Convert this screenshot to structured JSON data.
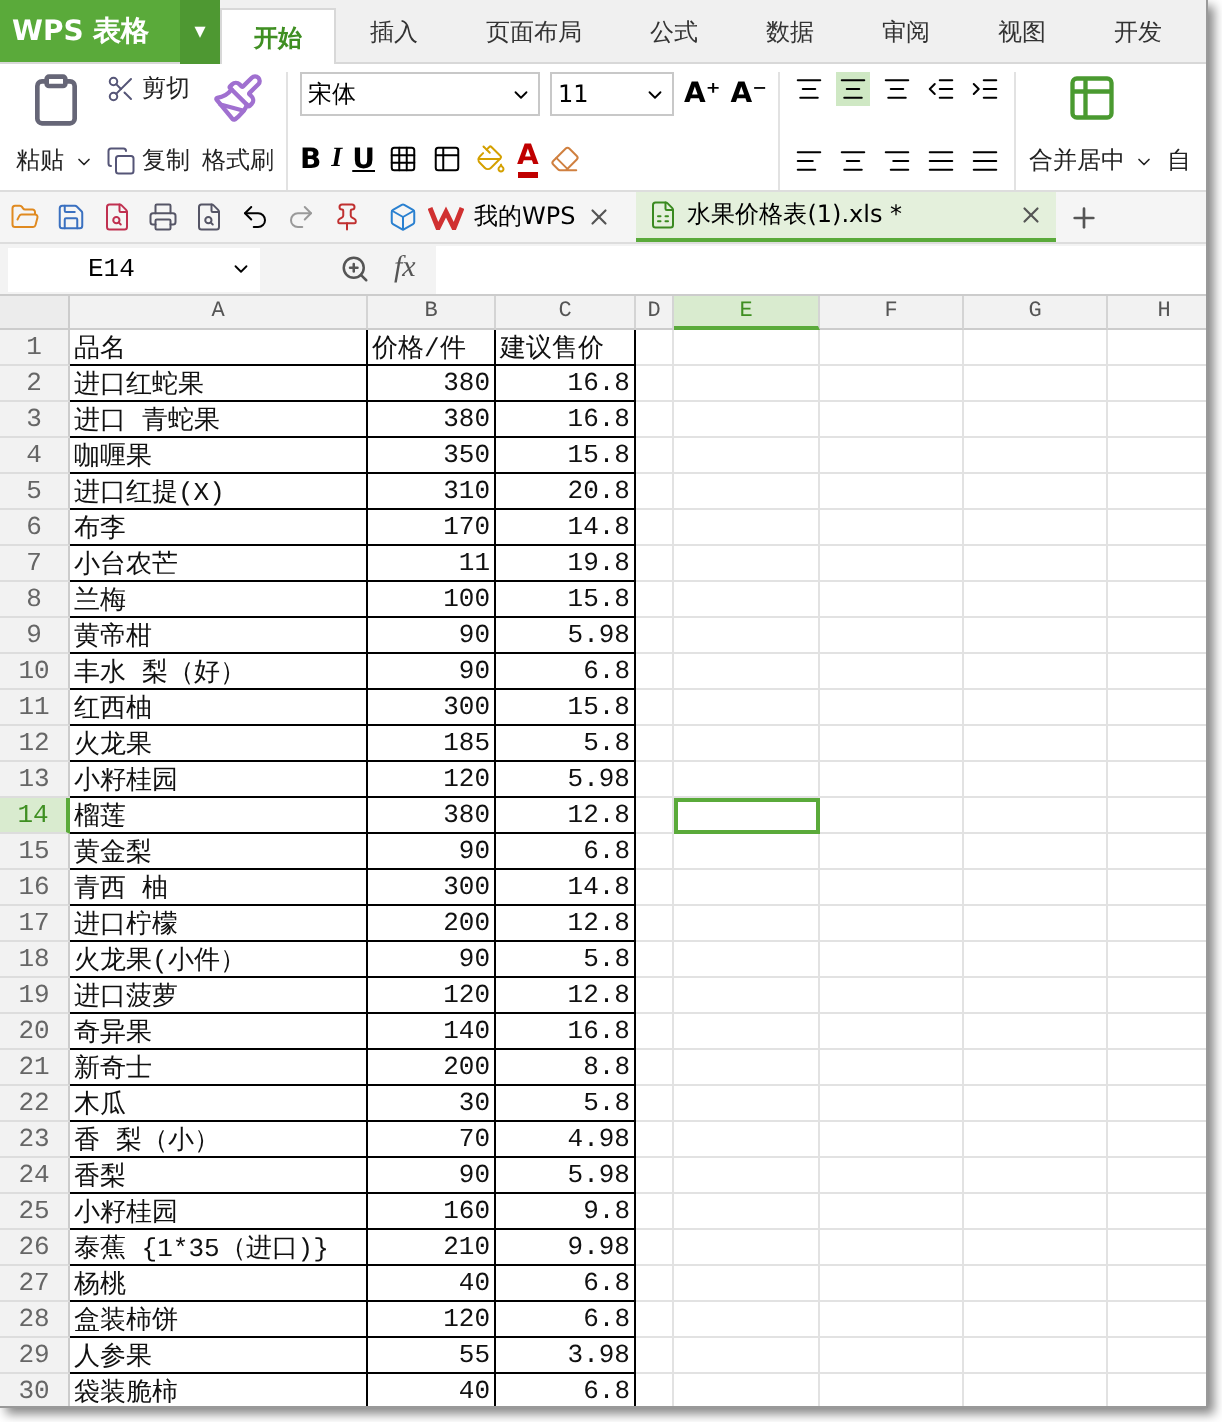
{
  "app": {
    "logo": "WPS 表格",
    "menu_caret": "▾"
  },
  "tabs": [
    {
      "label": "开始",
      "selected": true
    },
    {
      "label": "插入",
      "selected": false
    },
    {
      "label": "页面布局",
      "selected": false
    },
    {
      "label": "公式",
      "selected": false
    },
    {
      "label": "数据",
      "selected": false
    },
    {
      "label": "审阅",
      "selected": false
    },
    {
      "label": "视图",
      "selected": false
    },
    {
      "label": "开发",
      "selected": false
    }
  ],
  "ribbon": {
    "font_name": "宋体",
    "grow_font": "A⁺",
    "shrink_font": "A⁻",
    "italic": "I",
    "font_color": "A",
    "paste": "粘贴",
    "cut": "剪切",
    "copy": "复制",
    "format_painter": "格式刷",
    "font_size": "11",
    "bold": "B",
    "underline": "U",
    "merge": "合并居中",
    "wrap": "自",
    "align_center_active": true
  },
  "doc_tabs": [
    {
      "kind": "home",
      "label": "我的WPS",
      "selected": false
    },
    {
      "kind": "sheet",
      "label": "水果价格表(1).xls *",
      "selected": true
    }
  ],
  "formula_bar": {
    "name_box": "E14",
    "fx": "fx"
  },
  "columns": [
    {
      "label": "A",
      "selected": false
    },
    {
      "label": "B",
      "selected": false
    },
    {
      "label": "C",
      "selected": false
    },
    {
      "label": "D",
      "selected": false
    },
    {
      "label": "E",
      "selected": true
    },
    {
      "label": "F",
      "selected": false
    },
    {
      "label": "G",
      "selected": false
    },
    {
      "label": "H",
      "selected": false
    }
  ],
  "rows": [
    {
      "num": "1",
      "selected": false,
      "cells": [
        "品名",
        "价格/件",
        "建议售价"
      ]
    },
    {
      "num": "2",
      "selected": false,
      "cells": [
        "进口红蛇果",
        "380",
        "16.8"
      ]
    },
    {
      "num": "3",
      "selected": false,
      "cells": [
        "进口 青蛇果",
        "380",
        "16.8"
      ]
    },
    {
      "num": "4",
      "selected": false,
      "cells": [
        "咖喱果",
        "350",
        "15.8"
      ]
    },
    {
      "num": "5",
      "selected": false,
      "cells": [
        "进口红提(X)",
        "310",
        "20.8"
      ]
    },
    {
      "num": "6",
      "selected": false,
      "cells": [
        "布李",
        "170",
        "14.8"
      ]
    },
    {
      "num": "7",
      "selected": false,
      "cells": [
        "小台农芒",
        "11",
        "19.8"
      ]
    },
    {
      "num": "8",
      "selected": false,
      "cells": [
        "兰梅",
        "100",
        "15.8"
      ]
    },
    {
      "num": "9",
      "selected": false,
      "cells": [
        "黄帝柑",
        "90",
        "5.98"
      ]
    },
    {
      "num": "10",
      "selected": false,
      "cells": [
        "丰水 梨（好）",
        "90",
        "6.8"
      ]
    },
    {
      "num": "11",
      "selected": false,
      "cells": [
        "红西柚",
        "300",
        "15.8"
      ]
    },
    {
      "num": "12",
      "selected": false,
      "cells": [
        "火龙果",
        "185",
        "5.8"
      ]
    },
    {
      "num": "13",
      "selected": false,
      "cells": [
        "小籽桂园",
        "120",
        "5.98"
      ]
    },
    {
      "num": "14",
      "selected": true,
      "cells": [
        "榴莲",
        "380",
        "12.8"
      ]
    },
    {
      "num": "15",
      "selected": false,
      "cells": [
        "黄金梨",
        "90",
        "6.8"
      ]
    },
    {
      "num": "16",
      "selected": false,
      "cells": [
        "青西 柚",
        "300",
        "14.8"
      ]
    },
    {
      "num": "17",
      "selected": false,
      "cells": [
        "进口柠檬",
        "200",
        "12.8"
      ]
    },
    {
      "num": "18",
      "selected": false,
      "cells": [
        "火龙果(小件）",
        "90",
        "5.8"
      ]
    },
    {
      "num": "19",
      "selected": false,
      "cells": [
        "进口菠萝",
        "120",
        "12.8"
      ]
    },
    {
      "num": "20",
      "selected": false,
      "cells": [
        "奇异果",
        "140",
        "16.8"
      ]
    },
    {
      "num": "21",
      "selected": false,
      "cells": [
        "新奇士",
        "200",
        "8.8"
      ]
    },
    {
      "num": "22",
      "selected": false,
      "cells": [
        "木瓜",
        "30",
        "5.8"
      ]
    },
    {
      "num": "23",
      "selected": false,
      "cells": [
        "香 梨（小）",
        "70",
        "4.98"
      ]
    },
    {
      "num": "24",
      "selected": false,
      "cells": [
        "香梨",
        "90",
        "5.98"
      ]
    },
    {
      "num": "25",
      "selected": false,
      "cells": [
        "小籽桂园",
        "160",
        "9.8"
      ]
    },
    {
      "num": "26",
      "selected": false,
      "cells": [
        "泰蕉 {1*35（进口)}",
        "210",
        "9.98"
      ]
    },
    {
      "num": "27",
      "selected": false,
      "cells": [
        "杨桃",
        "40",
        "6.8"
      ]
    },
    {
      "num": "28",
      "selected": false,
      "cells": [
        "盒装柿饼",
        "120",
        "6.8"
      ]
    },
    {
      "num": "29",
      "selected": false,
      "cells": [
        "人参果",
        "55",
        "3.98"
      ]
    },
    {
      "num": "30",
      "selected": false,
      "cells": [
        "袋装脆柿",
        "40",
        "6.8"
      ]
    }
  ]
}
